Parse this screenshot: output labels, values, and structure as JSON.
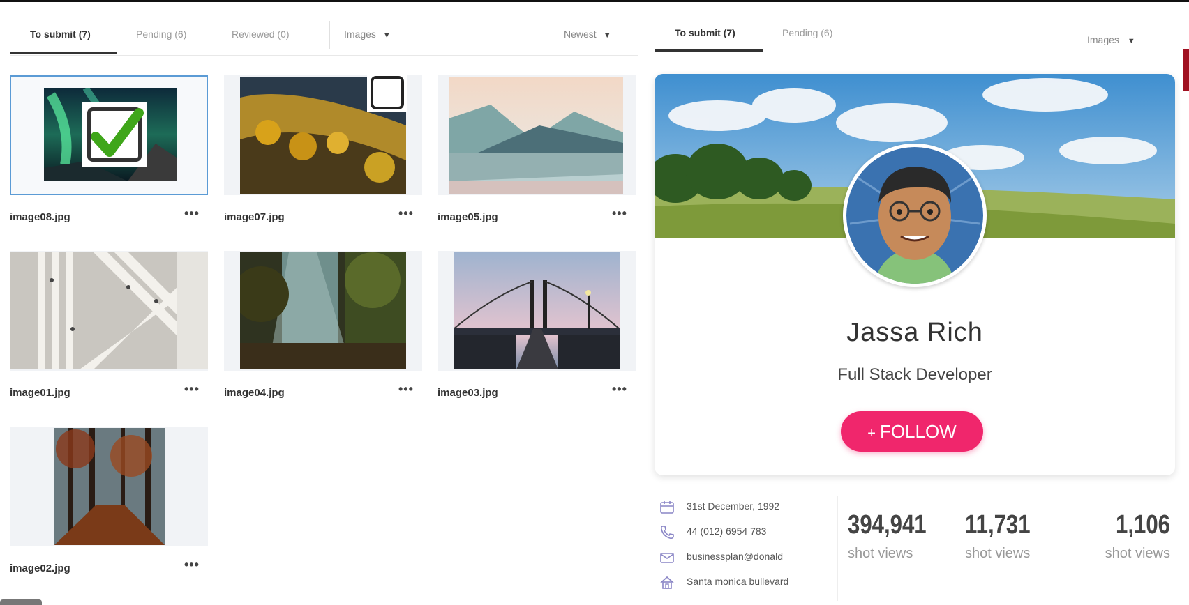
{
  "gallery": {
    "tabs": [
      {
        "label": "To submit (7)",
        "active": true
      },
      {
        "label": "Pending (6)",
        "active": false
      },
      {
        "label": "Reviewed (0)",
        "active": false
      }
    ],
    "type_filter": "Images",
    "sort": "Newest",
    "items": [
      {
        "name": "image08.jpg",
        "selected": true,
        "checked": true
      },
      {
        "name": "image07.jpg",
        "selected": false,
        "checked": false
      },
      {
        "name": "image05.jpg",
        "selected": false,
        "checked": false
      },
      {
        "name": "image01.jpg",
        "selected": false,
        "checked": false
      },
      {
        "name": "image04.jpg",
        "selected": false,
        "checked": false
      },
      {
        "name": "image03.jpg",
        "selected": false,
        "checked": false
      },
      {
        "name": "image02.jpg",
        "selected": false,
        "checked": false
      }
    ],
    "more_label": "•••"
  },
  "profile": {
    "tabs": [
      {
        "label": "To submit (7)",
        "active": true
      },
      {
        "label": "Pending (6)",
        "active": false
      }
    ],
    "type_filter": "Images",
    "name": "Jassa Rich",
    "role": "Full Stack Developer",
    "follow_label": "FOLLOW",
    "follow_icon": "+",
    "info": {
      "birthday": "31st December, 1992",
      "phone": "44 (012) 6954 783",
      "email": "businessplan@donald",
      "address": "Santa monica bullevard"
    },
    "stats": [
      {
        "value": "394,941",
        "label": "shot views"
      },
      {
        "value": "11,731",
        "label": "shot views"
      },
      {
        "value": "1,106",
        "label": "shot views"
      }
    ],
    "colors": {
      "follow": "#f0266c",
      "selected_border": "#5b9bd5"
    }
  }
}
